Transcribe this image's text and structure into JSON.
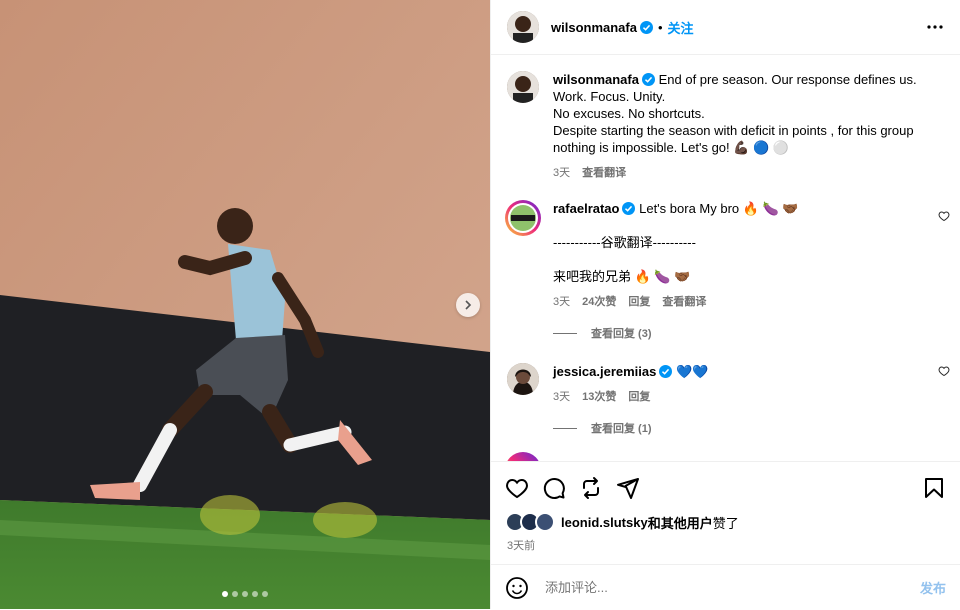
{
  "header": {
    "username": "wilsonmanafa",
    "separator": "•",
    "follow_label": "关注"
  },
  "caption": {
    "username": "wilsonmanafa",
    "lines": [
      "End of pre season. Our response defines us.",
      "Work. Focus. Unity.",
      "No excuses. No shortcuts.",
      "Despite starting the season with deficit in points , for this group nothing is impossible. Let's go! 💪🏿 🔵 ⚪"
    ],
    "time": "3天",
    "translate_label": "查看翻译"
  },
  "comments": [
    {
      "username": "rafaelratao",
      "text": "Let's bora My bro 🔥 🍆 🤝🏾",
      "translation_header": "-----------谷歌翻译----------",
      "translation": "来吧我的兄弟 🔥 🍆 🤝🏾",
      "time": "3天",
      "likes": "24次赞",
      "reply_label": "回复",
      "translate_label": "查看翻译",
      "view_replies": "查看回复 (3)"
    },
    {
      "username": "jessica.jeremiias",
      "text": "💙💙",
      "time": "3天",
      "likes": "13次赞",
      "reply_label": "回复",
      "view_replies": "查看回复 (1)"
    }
  ],
  "likes": {
    "username": "leonid.slutsky",
    "suffix_bold": "和其他用户",
    "suffix": "赞了"
  },
  "post_date": "3天前",
  "comment_input": {
    "placeholder": "添加评论...",
    "post_label": "发布"
  },
  "carousel": {
    "total": 5,
    "active": 0
  },
  "colors": {
    "accent": "#0095f6",
    "verified": "#0095f6",
    "muted": "#737373"
  },
  "icons": [
    "verified-icon",
    "more-icon",
    "heart-icon",
    "comment-icon",
    "share-icon",
    "send-icon",
    "bookmark-icon",
    "emoji-icon",
    "chevron-right-icon"
  ]
}
